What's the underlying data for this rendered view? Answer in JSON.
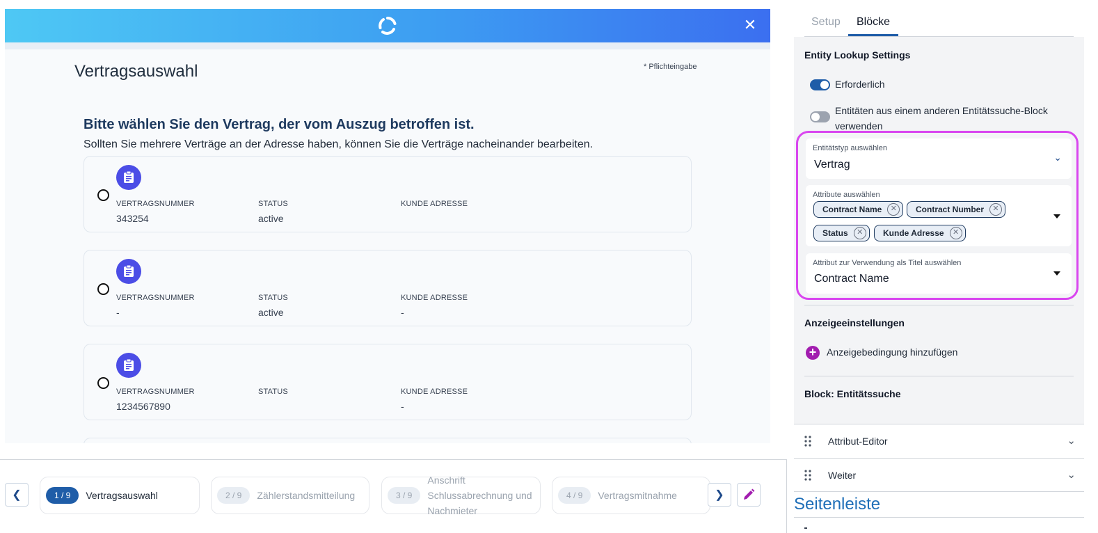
{
  "preview": {
    "page_title": "Vertragsauswahl",
    "required_note": "* Pflichteingabe",
    "heading": "Bitte wählen Sie den Vertrag, der vom Auszug betroffen ist.",
    "subheading": "Sollten Sie mehrere Verträge an der Adresse haben, können Sie die Verträge nacheinander bearbeiten.",
    "close_icon": "close-icon",
    "columns": [
      "VERTRAGSNUMMER",
      "STATUS",
      "KUNDE ADRESSE"
    ],
    "cards": [
      {
        "nummer": "343254",
        "status": "active",
        "adresse": ""
      },
      {
        "nummer": "-",
        "status": "active",
        "adresse": "-"
      },
      {
        "nummer": "1234567890",
        "status": "",
        "adresse": "-"
      }
    ]
  },
  "steps": [
    {
      "badge": "1 / 9",
      "label": "Vertragsauswahl",
      "active": true
    },
    {
      "badge": "2 / 9",
      "label": "Zählerstandsmitteilung",
      "active": false
    },
    {
      "badge": "3 / 9",
      "label": "Anschrift Schlussabrechnung und Nachmieter",
      "active": false
    },
    {
      "badge": "4 / 9",
      "label": "Vertragsmitnahme",
      "active": false
    }
  ],
  "panel": {
    "tabs": {
      "setup": "Setup",
      "bloecke": "Blöcke",
      "active": "bloecke"
    },
    "entity_settings_title": "Entity Lookup Settings",
    "toggle_required": {
      "label": "Erforderlich",
      "on": true
    },
    "toggle_other_block": {
      "label": "Entitäten aus einem anderen Entitätssuche-Block verwenden",
      "on": false
    },
    "entity_type": {
      "label": "Entitätstyp auswählen",
      "value": "Vertrag"
    },
    "attributes": {
      "label": "Attribute auswählen",
      "chips": [
        "Contract Name",
        "Contract Number",
        "Status",
        "Kunde Adresse"
      ]
    },
    "title_attribute": {
      "label": "Attribut zur Verwendung als Titel auswählen",
      "value": "Contract Name"
    },
    "display_settings_title": "Anzeigeeinstellungen",
    "add_condition": "Anzeigebedingung hinzufügen",
    "block_title": "Block: Entitätssuche",
    "accordions": [
      "Attribut-Editor",
      "Weiter"
    ],
    "sidebar_label": "Seitenleiste"
  },
  "colors": {
    "accent": "#1f5da8",
    "card_icon": "#4b4de6",
    "highlight": "#d946ef",
    "header_gradient_start": "#4ec8f4",
    "header_gradient_end": "#3b6ff0"
  }
}
